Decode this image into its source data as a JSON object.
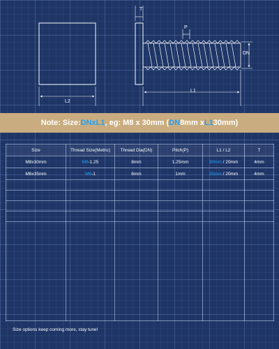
{
  "diagram": {
    "label_t": "T",
    "label_p": "P",
    "label_dn": "DN",
    "label_l1": "L1",
    "label_l2": "L2"
  },
  "note": {
    "prefix": "Note: Size: ",
    "dn": "DN",
    "x1": " x ",
    "l1": "L1",
    "mid": ", eg: M8 x 30mm (",
    "dn2": "DN",
    "mm8": " 8mm x ",
    "l1b": "L1",
    "end": " 30mm)"
  },
  "table": {
    "headers": [
      "Size",
      "Thread Size(Metric)",
      "Thread Dia(DN)",
      "Pitch(P)",
      "L1 / L2",
      "T"
    ],
    "rows": [
      {
        "size": "M8x30mm",
        "thread_code": "M8",
        "thread_pitch": "-1.25",
        "dia": "8mm",
        "pitch": "1.25mm",
        "l1": "30mm",
        "l2": " / 20mm",
        "t": "4mm"
      },
      {
        "size": "M6x35mm",
        "thread_code": "M6",
        "thread_pitch": "-1",
        "dia": "6mm",
        "pitch": "1mm",
        "l1": "35mm",
        "l2": " / 20mm",
        "t": "4mm"
      }
    ]
  },
  "footer": "Size options keep coming more, stay tune!",
  "colors": {
    "background": "#1e3566",
    "note_band": "#c9ad80",
    "highlight": "#1ea1ff"
  }
}
